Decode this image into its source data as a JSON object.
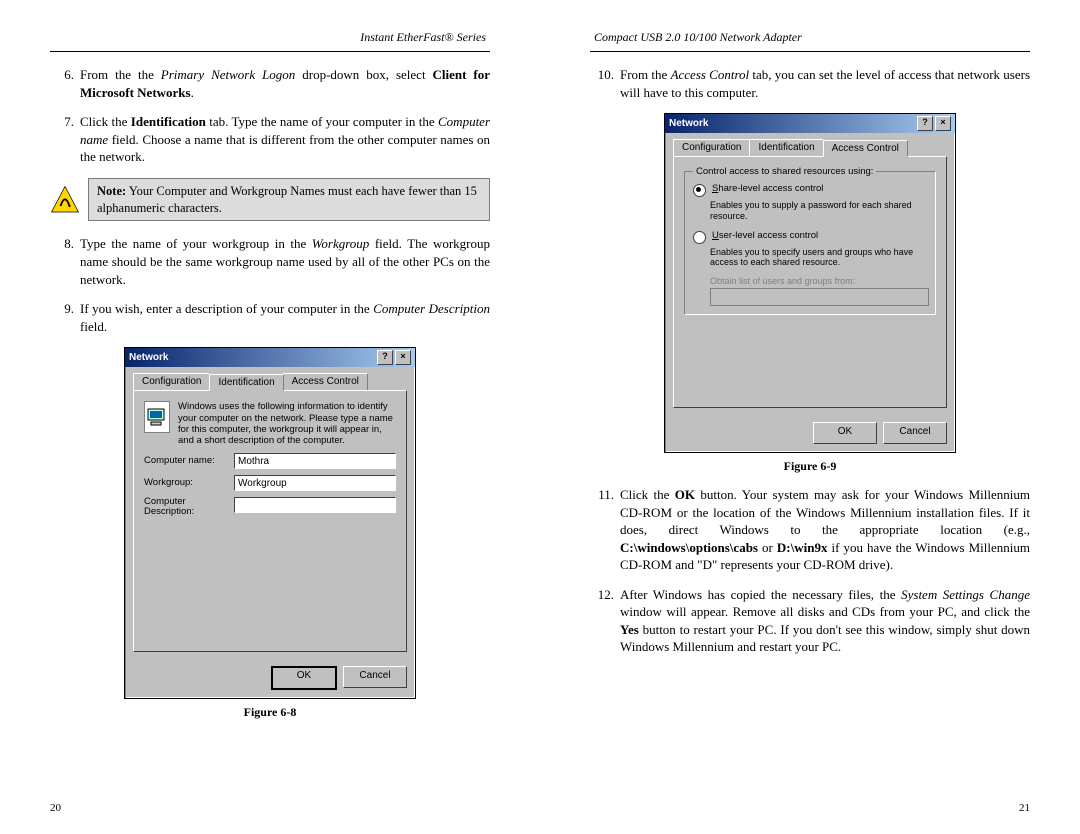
{
  "left_page": {
    "header": "Instant EtherFast® Series",
    "page_number": "20",
    "items": {
      "i6": {
        "num": "6.",
        "pre": "From the the ",
        "italic": "Primary Network Logon",
        "mid": " drop-down box, select ",
        "bold": "Client for Microsoft Networks",
        "post": "."
      },
      "i7": {
        "num": "7.",
        "pre": "Click the ",
        "bold": "Identification",
        "mid": " tab. Type the name of your computer in the ",
        "italic": "Computer name",
        "post": " field. Choose a name that is different from the other computer names on the network."
      },
      "i8": {
        "num": "8.",
        "pre": "Type the name of your workgroup in the ",
        "italic": "Workgroup",
        "post": " field. The workgroup name should be the same workgroup name used by all of the other PCs on the network."
      },
      "i9": {
        "num": "9.",
        "pre": "If you wish, enter a description of your computer in the ",
        "italic": "Computer Description",
        "post": " field."
      }
    },
    "note": {
      "bold": "Note:",
      "text": " Your Computer and Workgroup Names must each have fewer than 15 alphanumeric characters."
    },
    "figure_caption": "Figure 6-8",
    "dialog": {
      "title": "Network",
      "tabs": {
        "t1": "Configuration",
        "t2": "Identification",
        "t3": "Access Control"
      },
      "desc": "Windows uses the following information to identify your computer on the network. Please type a name for this computer, the workgroup it will appear in, and a short description of the computer.",
      "row1_label": "Computer name:",
      "row1_value": "Mothra",
      "row2_label": "Workgroup:",
      "row2_value": "Workgroup",
      "row3_label": "Computer Description:",
      "row3_value": "",
      "ok": "OK",
      "cancel": "Cancel"
    }
  },
  "right_page": {
    "header": "Compact USB 2.0 10/100 Network Adapter",
    "page_number": "21",
    "items": {
      "i10": {
        "num": "10.",
        "pre": "From the ",
        "italic": "Access Control",
        "post": " tab, you can set the level of access that network users will have to this computer."
      },
      "i11": {
        "num": "11.",
        "pre": "Click the ",
        "bold1": "OK",
        "mid1": " button. Your system may ask for your Windows Millennium CD-ROM or the location of the Windows Millennium installation files. If it does, direct Windows to the appropriate location (e.g., ",
        "bold2": "C:\\windows\\options\\cabs",
        "mid2": " or ",
        "bold3": "D:\\win9x",
        "post": " if you have the Windows Millennium CD-ROM and \"D\" represents your CD-ROM drive)."
      },
      "i12": {
        "num": "12.",
        "pre": "After Windows has copied the necessary files, the ",
        "italic": "System Settings Change",
        "mid": " window will appear. Remove all disks and CDs from your PC, and click the ",
        "bold": "Yes",
        "post": " button to restart your PC. If you don't see this window, simply shut down Windows Millennium and restart your PC."
      }
    },
    "figure_caption": "Figure 6-9",
    "dialog": {
      "title": "Network",
      "tabs": {
        "t1": "Configuration",
        "t2": "Identification",
        "t3": "Access Control"
      },
      "fieldset_label": "Control access to shared resources using:",
      "opt1": "Share-level access control",
      "opt1_desc": "Enables you to supply a password for each shared resource.",
      "opt2": "User-level access control",
      "opt2_desc": "Enables you to specify users and groups who have access to each shared resource.",
      "obtain_label": "Obtain list of users and groups from:",
      "ok": "OK",
      "cancel": "Cancel"
    }
  }
}
